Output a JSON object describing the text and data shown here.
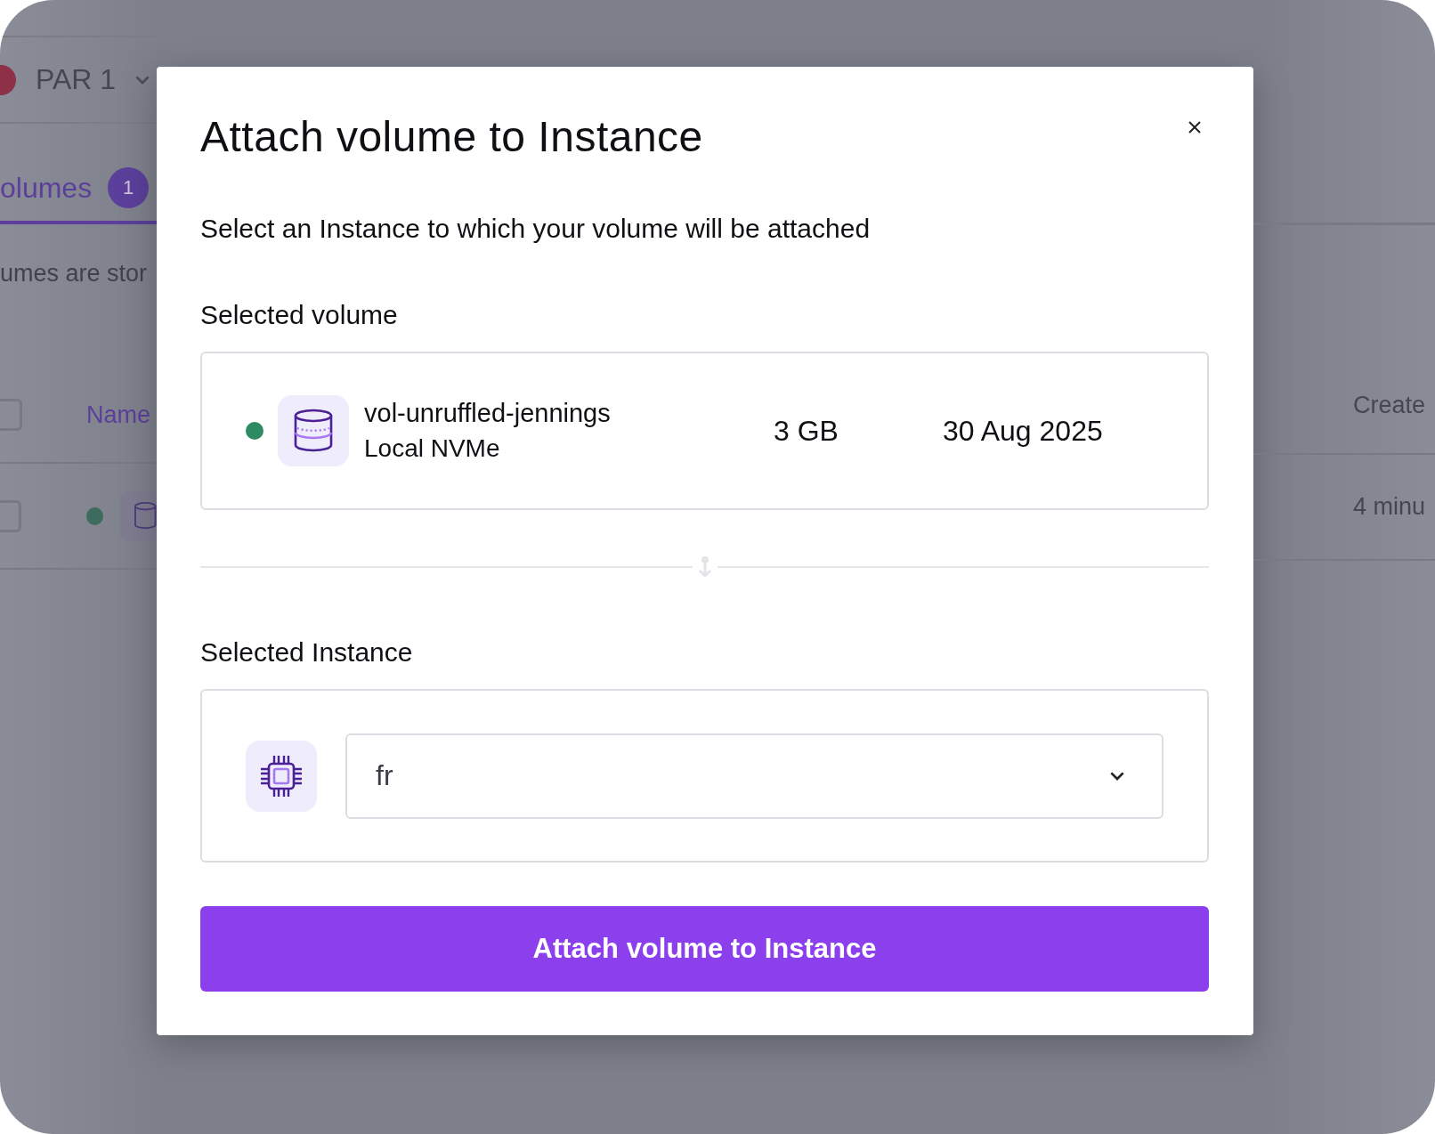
{
  "background_page": {
    "region_selector": {
      "label": "PAR 1"
    },
    "tab": {
      "label": "olumes",
      "count": "1",
      "selected": true
    },
    "description": "umes are stor",
    "table": {
      "header_checked": false,
      "columns": [
        "Name",
        "Create"
      ],
      "rows": [
        {
          "checked": false,
          "color": "#3d6b5e",
          "created": "4 minu"
        }
      ]
    }
  },
  "dialog": {
    "title": "Attach volume to Instance",
    "description": "Select an Instance to which your volume will be attached",
    "volume_section": {
      "heading": "Selected volume",
      "volume": {
        "color": "#2e8a62",
        "name": "vol-unruffled-jennings",
        "type": "Local NVMe",
        "size": "3 GB",
        "date": "30 Aug 2025"
      }
    },
    "instance_section": {
      "heading": "Selected Instance",
      "select": {
        "value": "fr"
      }
    },
    "submit": {
      "label": "Attach volume to Instance"
    }
  }
}
